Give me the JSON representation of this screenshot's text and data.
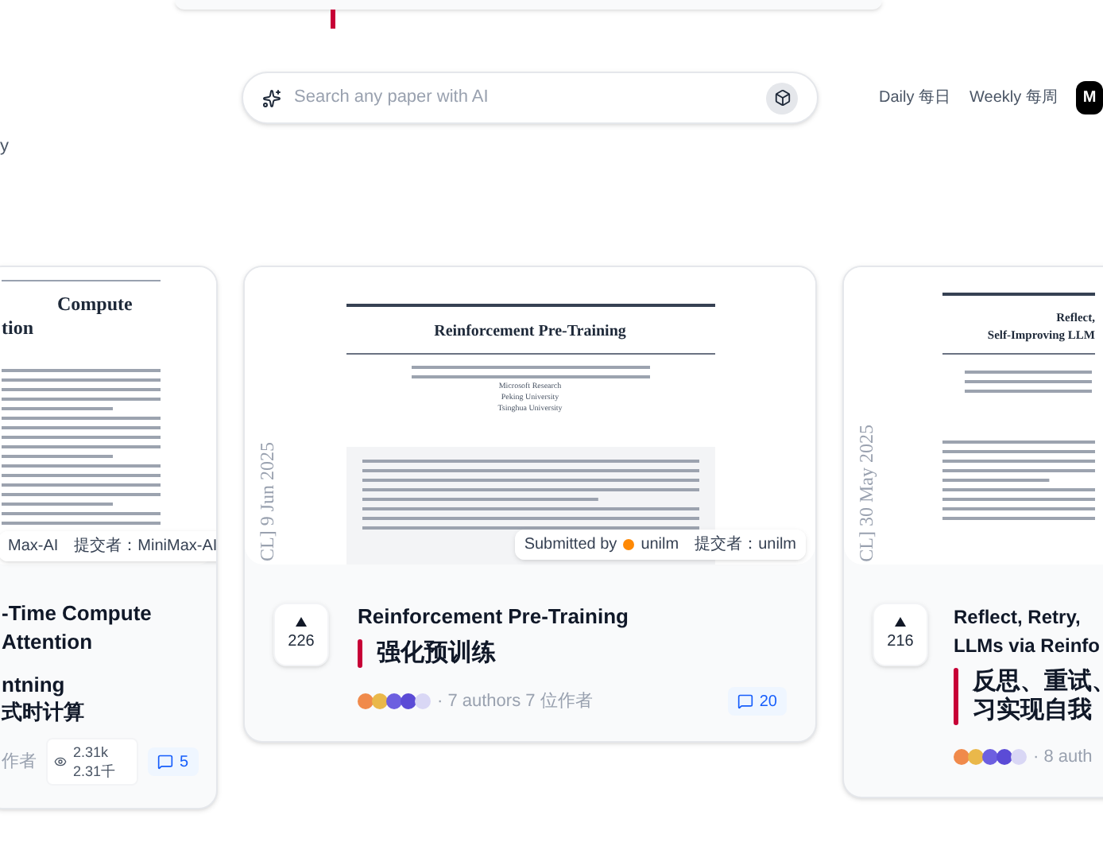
{
  "side_text": "y",
  "search": {
    "placeholder": "Search any paper with AI"
  },
  "period_tabs": [
    {
      "label": "Daily 每日",
      "selected": false
    },
    {
      "label": "Weekly 每周",
      "selected": false
    },
    {
      "label": "M",
      "selected": true
    }
  ],
  "papers": [
    {
      "kind": "clipped_left",
      "thumbnail": {
        "title_lines": [
          "Compute",
          "tion"
        ],
        "submitter": {
          "name": "Max-AI",
          "zh": "提交者：MiniMax-AI",
          "avatar": false
        }
      },
      "title_lines": [
        "-Time Compute",
        "Attention"
      ],
      "zh_title_lines": [
        "ntning",
        "式时计算"
      ],
      "authors": "作者",
      "views": "2.31k 2.31千",
      "comments": "5"
    },
    {
      "kind": "full",
      "thumbnail": {
        "title_lines": [
          "Reinforcement Pre-Training"
        ],
        "date": "CL]  9 Jun 2025",
        "affiliations": [
          "Microsoft Research",
          "Peking University",
          "Tsinghua University"
        ],
        "submitter": {
          "label": "Submitted by",
          "name": "unilm",
          "zh": "提交者：unilm",
          "avatar": true
        }
      },
      "upvotes": "226",
      "title_lines": [
        "Reinforcement Pre-Training"
      ],
      "zh_title_lines": [
        "强化预训练"
      ],
      "authors": "· 7 authors 7 位作者",
      "comments": "20"
    },
    {
      "kind": "clipped_right",
      "thumbnail": {
        "title_lines": [
          "Reflect,",
          "Self-Improving LLM"
        ],
        "date": "CL]  30 May 2025"
      },
      "upvotes": "216",
      "title_lines": [
        "Reflect, Retry,",
        "LLMs via Reinfo"
      ],
      "zh_title_lines": [
        "反思、重试、",
        "习实现自我"
      ],
      "authors": "· 8 auth"
    }
  ]
}
